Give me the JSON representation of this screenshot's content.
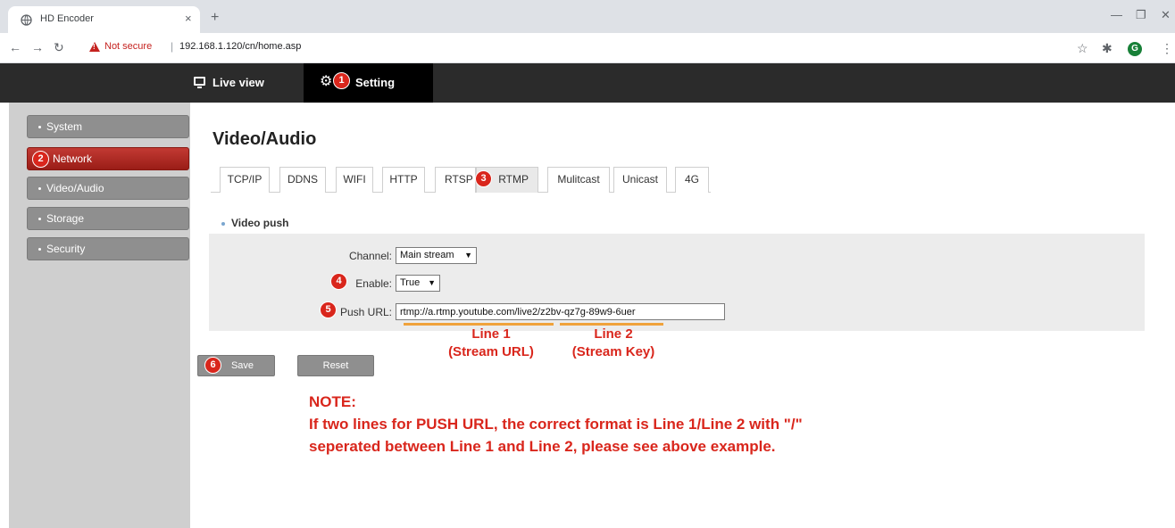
{
  "browser": {
    "tab_title": "HD Encoder",
    "tab_close": "×",
    "new_tab": "+",
    "not_secure": "Not secure",
    "url": "192.168.1.120/cn/home.asp",
    "profile_initial": "G",
    "icons": [
      "back-arrow",
      "forward-arrow",
      "reload",
      "warning-triangle",
      "star",
      "puzzle-extension",
      "profile-avatar",
      "menu-dots"
    ]
  },
  "header": {
    "live_view": "Live view",
    "setting": "Setting"
  },
  "sidebar": {
    "items": [
      {
        "label": "System"
      },
      {
        "label": "Network",
        "active": true
      },
      {
        "label": "Video/Audio"
      },
      {
        "label": "Storage"
      },
      {
        "label": "Security"
      }
    ]
  },
  "main": {
    "title": "Video/Audio",
    "tabs": [
      "TCP/IP",
      "DDNS",
      "WIFI",
      "HTTP",
      "RTSP",
      "RTMP",
      "Mulitcast",
      "Unicast",
      "4G"
    ],
    "active_tab": "RTMP",
    "section_title": "Video push",
    "form": {
      "channel_label": "Channel:",
      "channel_value": "Main stream",
      "enable_label": "Enable:",
      "enable_value": "True",
      "push_url_label": "Push URL:",
      "push_url_value": "rtmp://a.rtmp.youtube.com/live2/z2bv-qz7g-89w9-6uer"
    },
    "buttons": {
      "save": "Save",
      "reset": "Reset"
    }
  },
  "steps": [
    "1",
    "2",
    "3",
    "4",
    "5",
    "6"
  ],
  "annotations": {
    "line1_title": "Line 1",
    "line1_sub": "(Stream URL)",
    "line2_title": "Line 2",
    "line2_sub": "(Stream Key)",
    "note_title": "NOTE:",
    "note_line1": "If two lines for PUSH URL, the correct format is Line 1/Line 2 with \"/\"",
    "note_line2": "seperated between Line 1 and Line 2, please see above example."
  },
  "colors": {
    "accent_red": "#d9261c",
    "header_bg": "#2b2b2b",
    "sidebar_bg": "#cfcfcf",
    "underline": "#f0a23b"
  }
}
